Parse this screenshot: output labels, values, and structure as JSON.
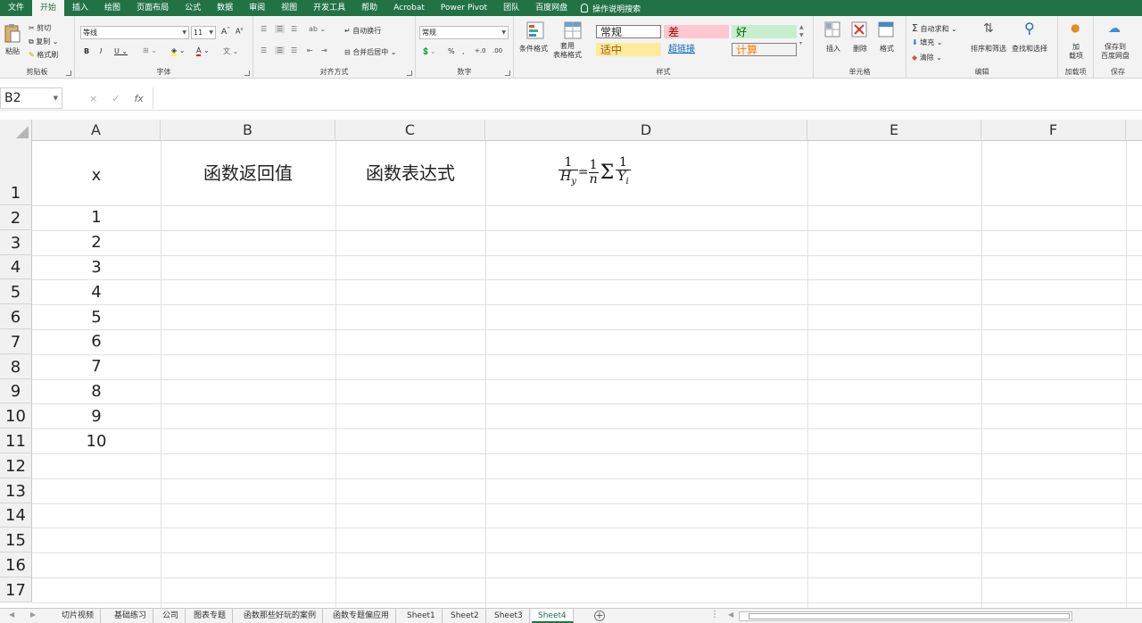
{
  "menu": {
    "items": [
      "文件",
      "开始",
      "插入",
      "绘图",
      "页面布局",
      "公式",
      "数据",
      "审阅",
      "视图",
      "开发工具",
      "帮助",
      "Acrobat",
      "Power Pivot",
      "团队",
      "百度网盘"
    ],
    "active_index": 1,
    "tell_me": "操作说明搜索"
  },
  "ribbon": {
    "clipboard": {
      "label": "剪贴板",
      "paste": "粘贴",
      "cut": "剪切",
      "copy": "复制",
      "format_painter": "格式刷"
    },
    "font": {
      "label": "字体",
      "font_name": "等线",
      "font_size": "11"
    },
    "alignment": {
      "label": "对齐方式",
      "wrap_text": "自动换行",
      "merge_center": "合并后居中"
    },
    "number": {
      "label": "数字",
      "format": "常规"
    },
    "styles": {
      "label": "样式",
      "conditional_format": "条件格式",
      "table_format": "套用\n表格格式",
      "cells": [
        {
          "text": "常规",
          "bg": "#ffffff",
          "color": "#222222"
        },
        {
          "text": "差",
          "bg": "#ffc7ce",
          "color": "#9c0006"
        },
        {
          "text": "好",
          "bg": "#c6efce",
          "color": "#006100"
        },
        {
          "text": "适中",
          "bg": "#ffeb9c",
          "color": "#9c5700"
        },
        {
          "text": "超链接",
          "bg": "#f3f3f3",
          "color": "#0563c1"
        },
        {
          "text": "计算",
          "bg": "#f2f2f2",
          "color": "#fa7d00"
        }
      ]
    },
    "cells_group": {
      "label": "单元格",
      "insert": "插入",
      "delete": "删除",
      "format": "格式"
    },
    "editing": {
      "label": "编辑",
      "autosum": "自动求和",
      "fill": "填充",
      "clear": "清除",
      "sort_filter": "排序和筛选",
      "find_select": "查找和选择"
    },
    "addins": {
      "label": "加载项",
      "addin": "加\n载项"
    },
    "save": {
      "label": "保存",
      "save_baidu": "保存到\n百度网盘"
    }
  },
  "formula_bar": {
    "name_box": "B2",
    "cancel": "×",
    "enter": "✓",
    "fx": "fx",
    "value": ""
  },
  "grid": {
    "columns": [
      "A",
      "B",
      "C",
      "D",
      "E",
      "F"
    ],
    "rows": [
      "1",
      "2",
      "3",
      "4",
      "5",
      "6",
      "7",
      "8",
      "9",
      "10",
      "11",
      "12",
      "13",
      "14",
      "15",
      "16",
      "17"
    ],
    "headers_row1": {
      "A": "x",
      "B": "函数返回值",
      "C": "函数表达式"
    },
    "formula_image": {
      "lhs_num": "1",
      "lhs_den": "H",
      "lhs_den_sub": "y",
      "eq": "=",
      "n_num": "1",
      "n_den": "n",
      "sigma": "Σ",
      "rhs_num": "1",
      "rhs_den": "Y",
      "rhs_den_sub": "i"
    },
    "x_values": [
      "1",
      "2",
      "3",
      "4",
      "5",
      "6",
      "7",
      "8",
      "9",
      "10"
    ]
  },
  "sheets": {
    "tabs": [
      "切片视频",
      "基础练习",
      "公司",
      "图表专题",
      "函数那些好玩的案例",
      "函数专题偏应用",
      "Sheet1",
      "Sheet2",
      "Sheet3",
      "Sheet4"
    ],
    "active_index": 9
  }
}
